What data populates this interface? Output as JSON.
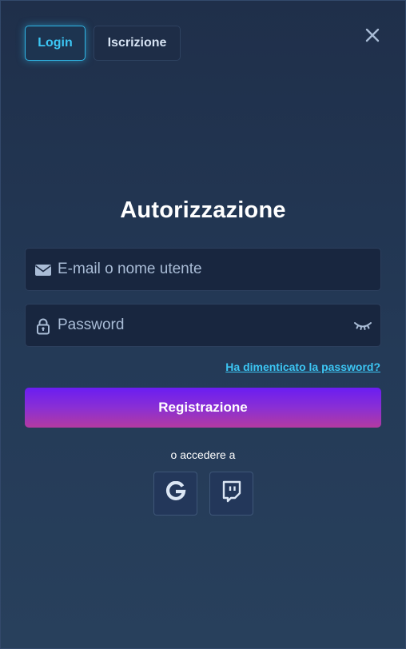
{
  "tabs": {
    "login_label": "Login",
    "signup_label": "Iscrizione"
  },
  "title": "Autorizzazione",
  "email_field": {
    "placeholder": "E-mail o nome utente",
    "value": "",
    "icon": "envelope-icon"
  },
  "password_field": {
    "placeholder": "Password",
    "value": "",
    "icon": "lock-icon",
    "toggle_icon": "eye-closed-icon"
  },
  "forgot_password_label": "Ha dimenticato la password?",
  "submit_label": "Registrazione",
  "social": {
    "divider_text": "o accedere a",
    "providers": [
      {
        "icon": "google-icon"
      },
      {
        "icon": "twitch-icon"
      }
    ]
  },
  "close_icon": "close-icon",
  "colors": {
    "accent": "#3cc6f4",
    "background": "#22324d",
    "field_background": "#18263f",
    "button_gradient_top": "#6a1df2",
    "button_gradient_bottom": "#b33aa1",
    "icon": "#a9bcd6"
  }
}
